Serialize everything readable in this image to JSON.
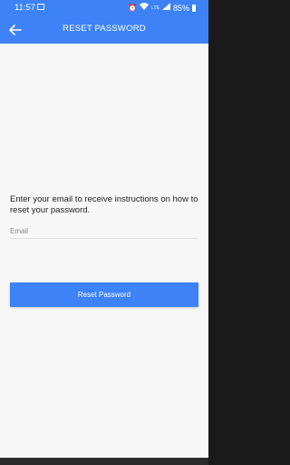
{
  "status_bar": {
    "time": "11:57",
    "network": "LTE",
    "battery": "85%"
  },
  "toolbar": {
    "title": "RESET PASSWORD"
  },
  "form": {
    "instructions": "Enter your email to receive instructions on how to reset your password.",
    "email_placeholder": "Email",
    "submit_label": "Reset Password"
  },
  "colors": {
    "primary": "#3d82f6",
    "background": "#f7f7f7"
  }
}
